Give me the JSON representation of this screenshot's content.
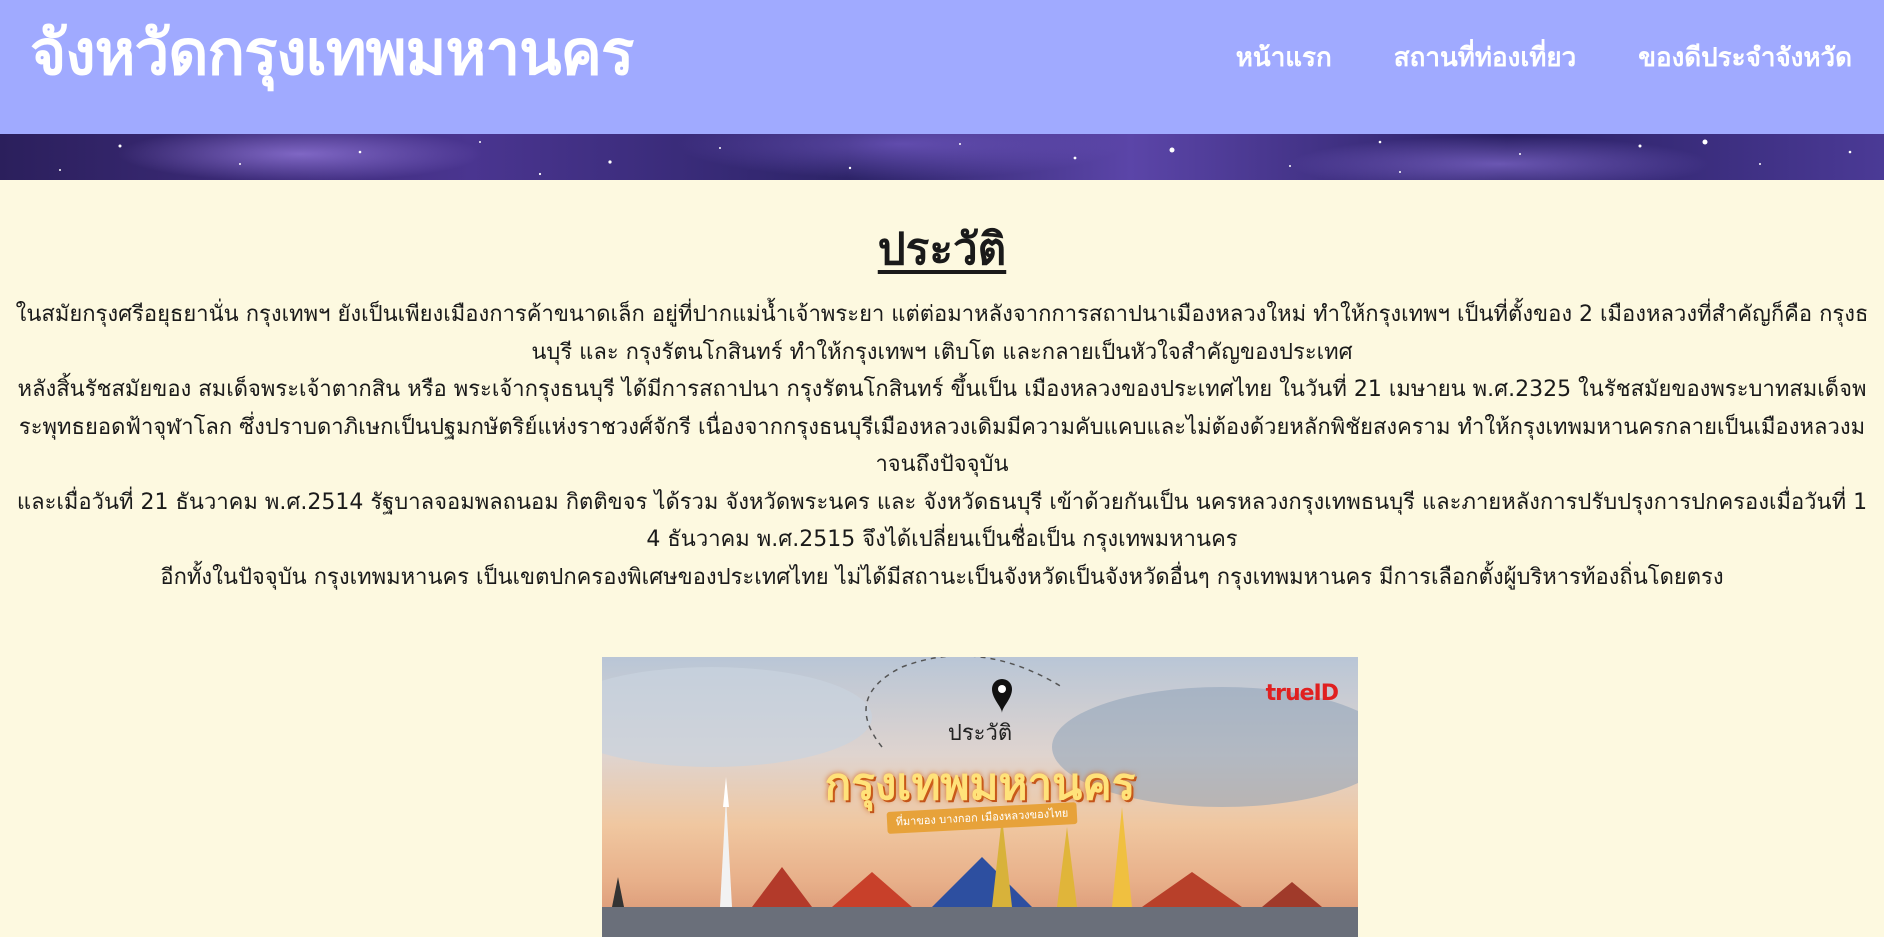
{
  "header": {
    "title": "จังหวัดกรุงเทพมหานคร",
    "nav": [
      {
        "label": "หน้าแรก"
      },
      {
        "label": "สถานที่ท่องเที่ยว"
      },
      {
        "label": "ของดีประจำจังหวัด"
      }
    ]
  },
  "main": {
    "section_title": "ประวัติ",
    "paragraphs": [
      "ในสมัยกรุงศรีอยุธยานั่น กรุงเทพฯ ยังเป็นเพียงเมืองการค้าขนาดเล็ก อยู่ที่ปากแม่น้ำเจ้าพระยา แต่ต่อมาหลังจากการสถาปนาเมืองหลวงใหม่ ทำให้กรุงเทพฯ เป็นที่ตั้งของ 2 เมืองหลวงที่สำคัญก็คือ กรุงธนบุรี และ กรุงรัตนโกสินทร์ ทำให้กรุงเทพฯ เติบโต และกลายเป็นหัวใจสำคัญของประเทศ",
      "หลังสิ้นรัชสมัยของ สมเด็จพระเจ้าตากสิน หรือ พระเจ้ากรุงธนบุรี ได้มีการสถาปนา กรุงรัตนโกสินทร์ ขึ้นเป็น เมืองหลวงของประเทศไทย ในวันที่ 21 เมษายน พ.ศ.2325 ในรัชสมัยของพระบาทสมเด็จพระพุทธยอดฟ้าจุฬาโลก ซึ่งปราบดาภิเษกเป็นปฐมกษัตริย์แห่งราชวงศ์จักรี เนื่องจากกรุงธนบุรีเมืองหลวงเดิมมีความคับแคบและไม่ต้องด้วยหลักพิชัยสงคราม ทำให้กรุงเทพมหานครกลายเป็นเมืองหลวงมาจนถึงปัจจุบัน",
      "และเมื่อวันที่ 21 ธันวาคม พ.ศ.2514 รัฐบาลจอมพลถนอม กิตติขจร ได้รวม จังหวัดพระนคร และ จังหวัดธนบุรี เข้าด้วยกันเป็น นครหลวงกรุงเทพธนบุรี และภายหลังการปรับปรุงการปกครองเมื่อวันที่ 14 ธันวาคม พ.ศ.2515 จึงได้เปลี่ยนเป็นชื่อเป็น กรุงเทพมหานคร",
      "อีกทั้งในปัจจุบัน กรุงเทพมหานคร เป็นเขตปกครองพิเศษของประเทศไทย ไม่ได้มีสถานะเป็นจังหวัดเป็นจังหวัดอื่นๆ กรุงเทพมหานคร มีการเลือกตั้งผู้บริหารท้องถิ่นโดยตรง"
    ],
    "hero_image": {
      "label": "ประวัติ",
      "name": "กรุงเทพมหานคร",
      "tagline": "ที่มาของ บางกอก เมืองหลวงของไทย",
      "logo": "trueID",
      "pin_icon": "location-pin-icon"
    }
  },
  "colors": {
    "header_bg": "#a0aaff",
    "page_bg": "#fdf9e0",
    "text": "#1a1a1a"
  }
}
